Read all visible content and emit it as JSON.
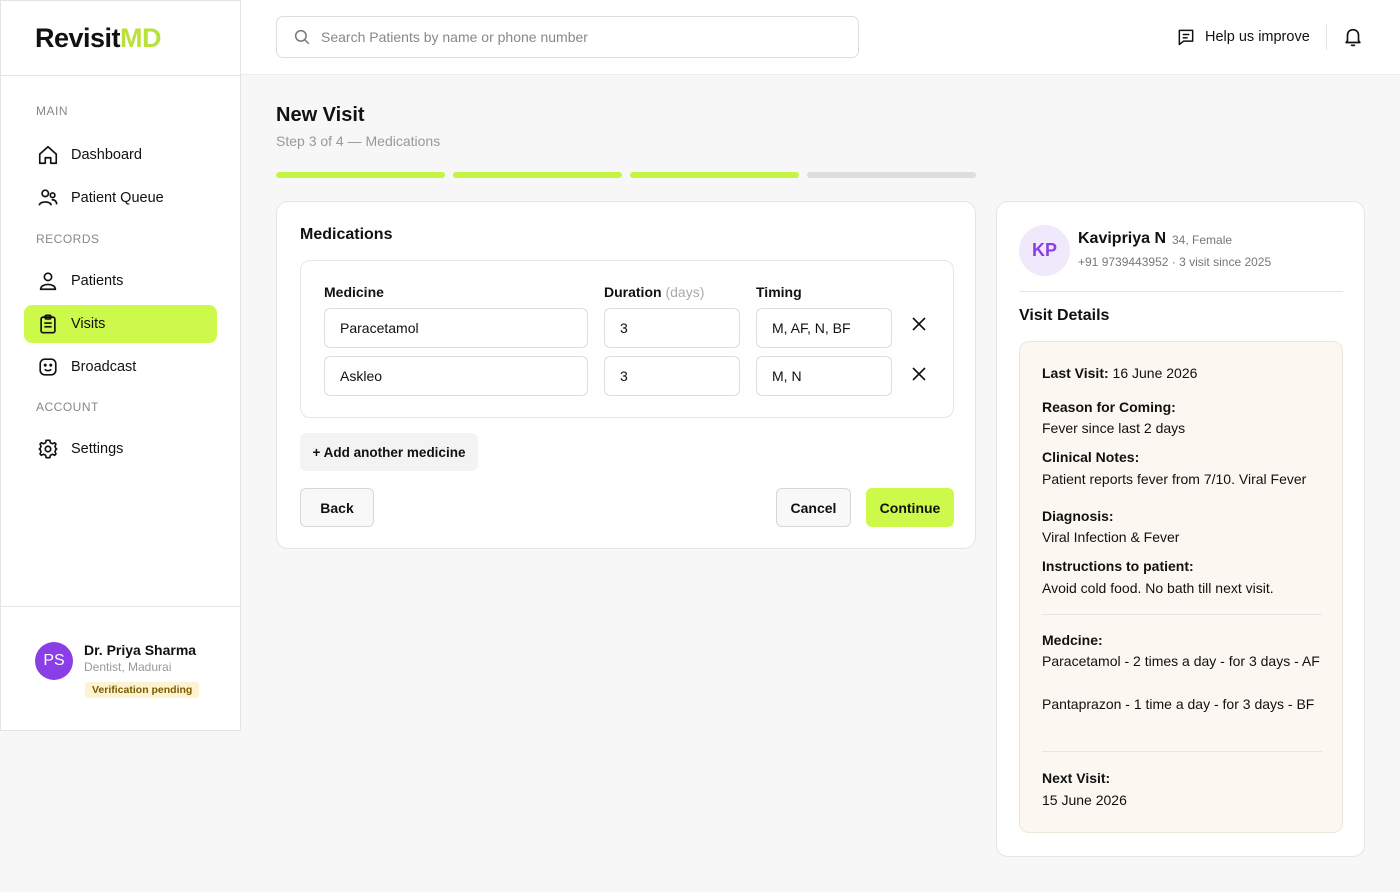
{
  "brand": {
    "name_dark": "Revisit",
    "name_accent": "MD"
  },
  "sidebar": {
    "sections": [
      {
        "label": "MAIN"
      },
      {
        "label": "RECORDS"
      },
      {
        "label": "ACCOUNT"
      }
    ],
    "items": [
      {
        "label": "Dashboard",
        "icon": "home-icon"
      },
      {
        "label": "Patient Queue",
        "icon": "users-icon"
      },
      {
        "label": "Patients",
        "icon": "user-icon"
      },
      {
        "label": "Visits",
        "icon": "clipboard-icon",
        "active": true
      },
      {
        "label": "Broadcast",
        "icon": "smile-icon"
      },
      {
        "label": "Settings",
        "icon": "gear-icon"
      }
    ],
    "user": {
      "initials": "PS",
      "name": "Dr. Priya Sharma",
      "role": "Dentist, Madurai",
      "badge": "Verification pending"
    }
  },
  "topbar": {
    "search_placeholder": "Search Patients by name or phone number",
    "help_label": "Help us improve"
  },
  "page": {
    "title": "New Visit",
    "subtitle": "Step 3 of 4 — Medications",
    "progress": {
      "current_step": 3,
      "total_steps": 4
    }
  },
  "medications": {
    "title": "Medications",
    "headers": {
      "medicine": "Medicine",
      "duration": "Duration",
      "duration_unit": "(days)",
      "timing": "Timing"
    },
    "rows": [
      {
        "medicine": "Paracetamol",
        "duration": "3",
        "timing": "M, AF, N, BF"
      },
      {
        "medicine": "Askleo",
        "duration": "3",
        "timing": "M, N"
      }
    ],
    "add_label": "+ Add another medicine",
    "back_label": "Back",
    "cancel_label": "Cancel",
    "continue_label": "Continue"
  },
  "patient": {
    "initials": "KP",
    "name": "Kavipriya N",
    "meta": "34, Female",
    "contact": "+91 9739443952 · 3 visit since 2025",
    "visit_details_title": "Visit Details",
    "last_visit_label": "Last Visit:",
    "last_visit": "16 June 2026",
    "reason_label": "Reason for Coming:",
    "reason": "Fever since last 2 days",
    "notes_label": "Clinical Notes:",
    "notes": "Patient reports fever from 7/10. Viral Fever",
    "diagnosis_label": "Diagnosis:",
    "diagnosis": "Viral Infection & Fever",
    "instructions_label": "Instructions to patient:",
    "instructions": "Avoid cold food. No bath till next visit.",
    "medicine_label": "Medcine:",
    "medicine_1": "Paracetamol - 2 times a day - for 3 days - AF",
    "medicine_2": "Pantaprazon - 1 time a day - for 3 days - BF",
    "next_visit_label": "Next Visit:",
    "next_visit": "15 June 2026"
  },
  "colors": {
    "accent": "#cdfa4a",
    "progress": "#c5f443",
    "avatar": "#8a3ee6"
  }
}
